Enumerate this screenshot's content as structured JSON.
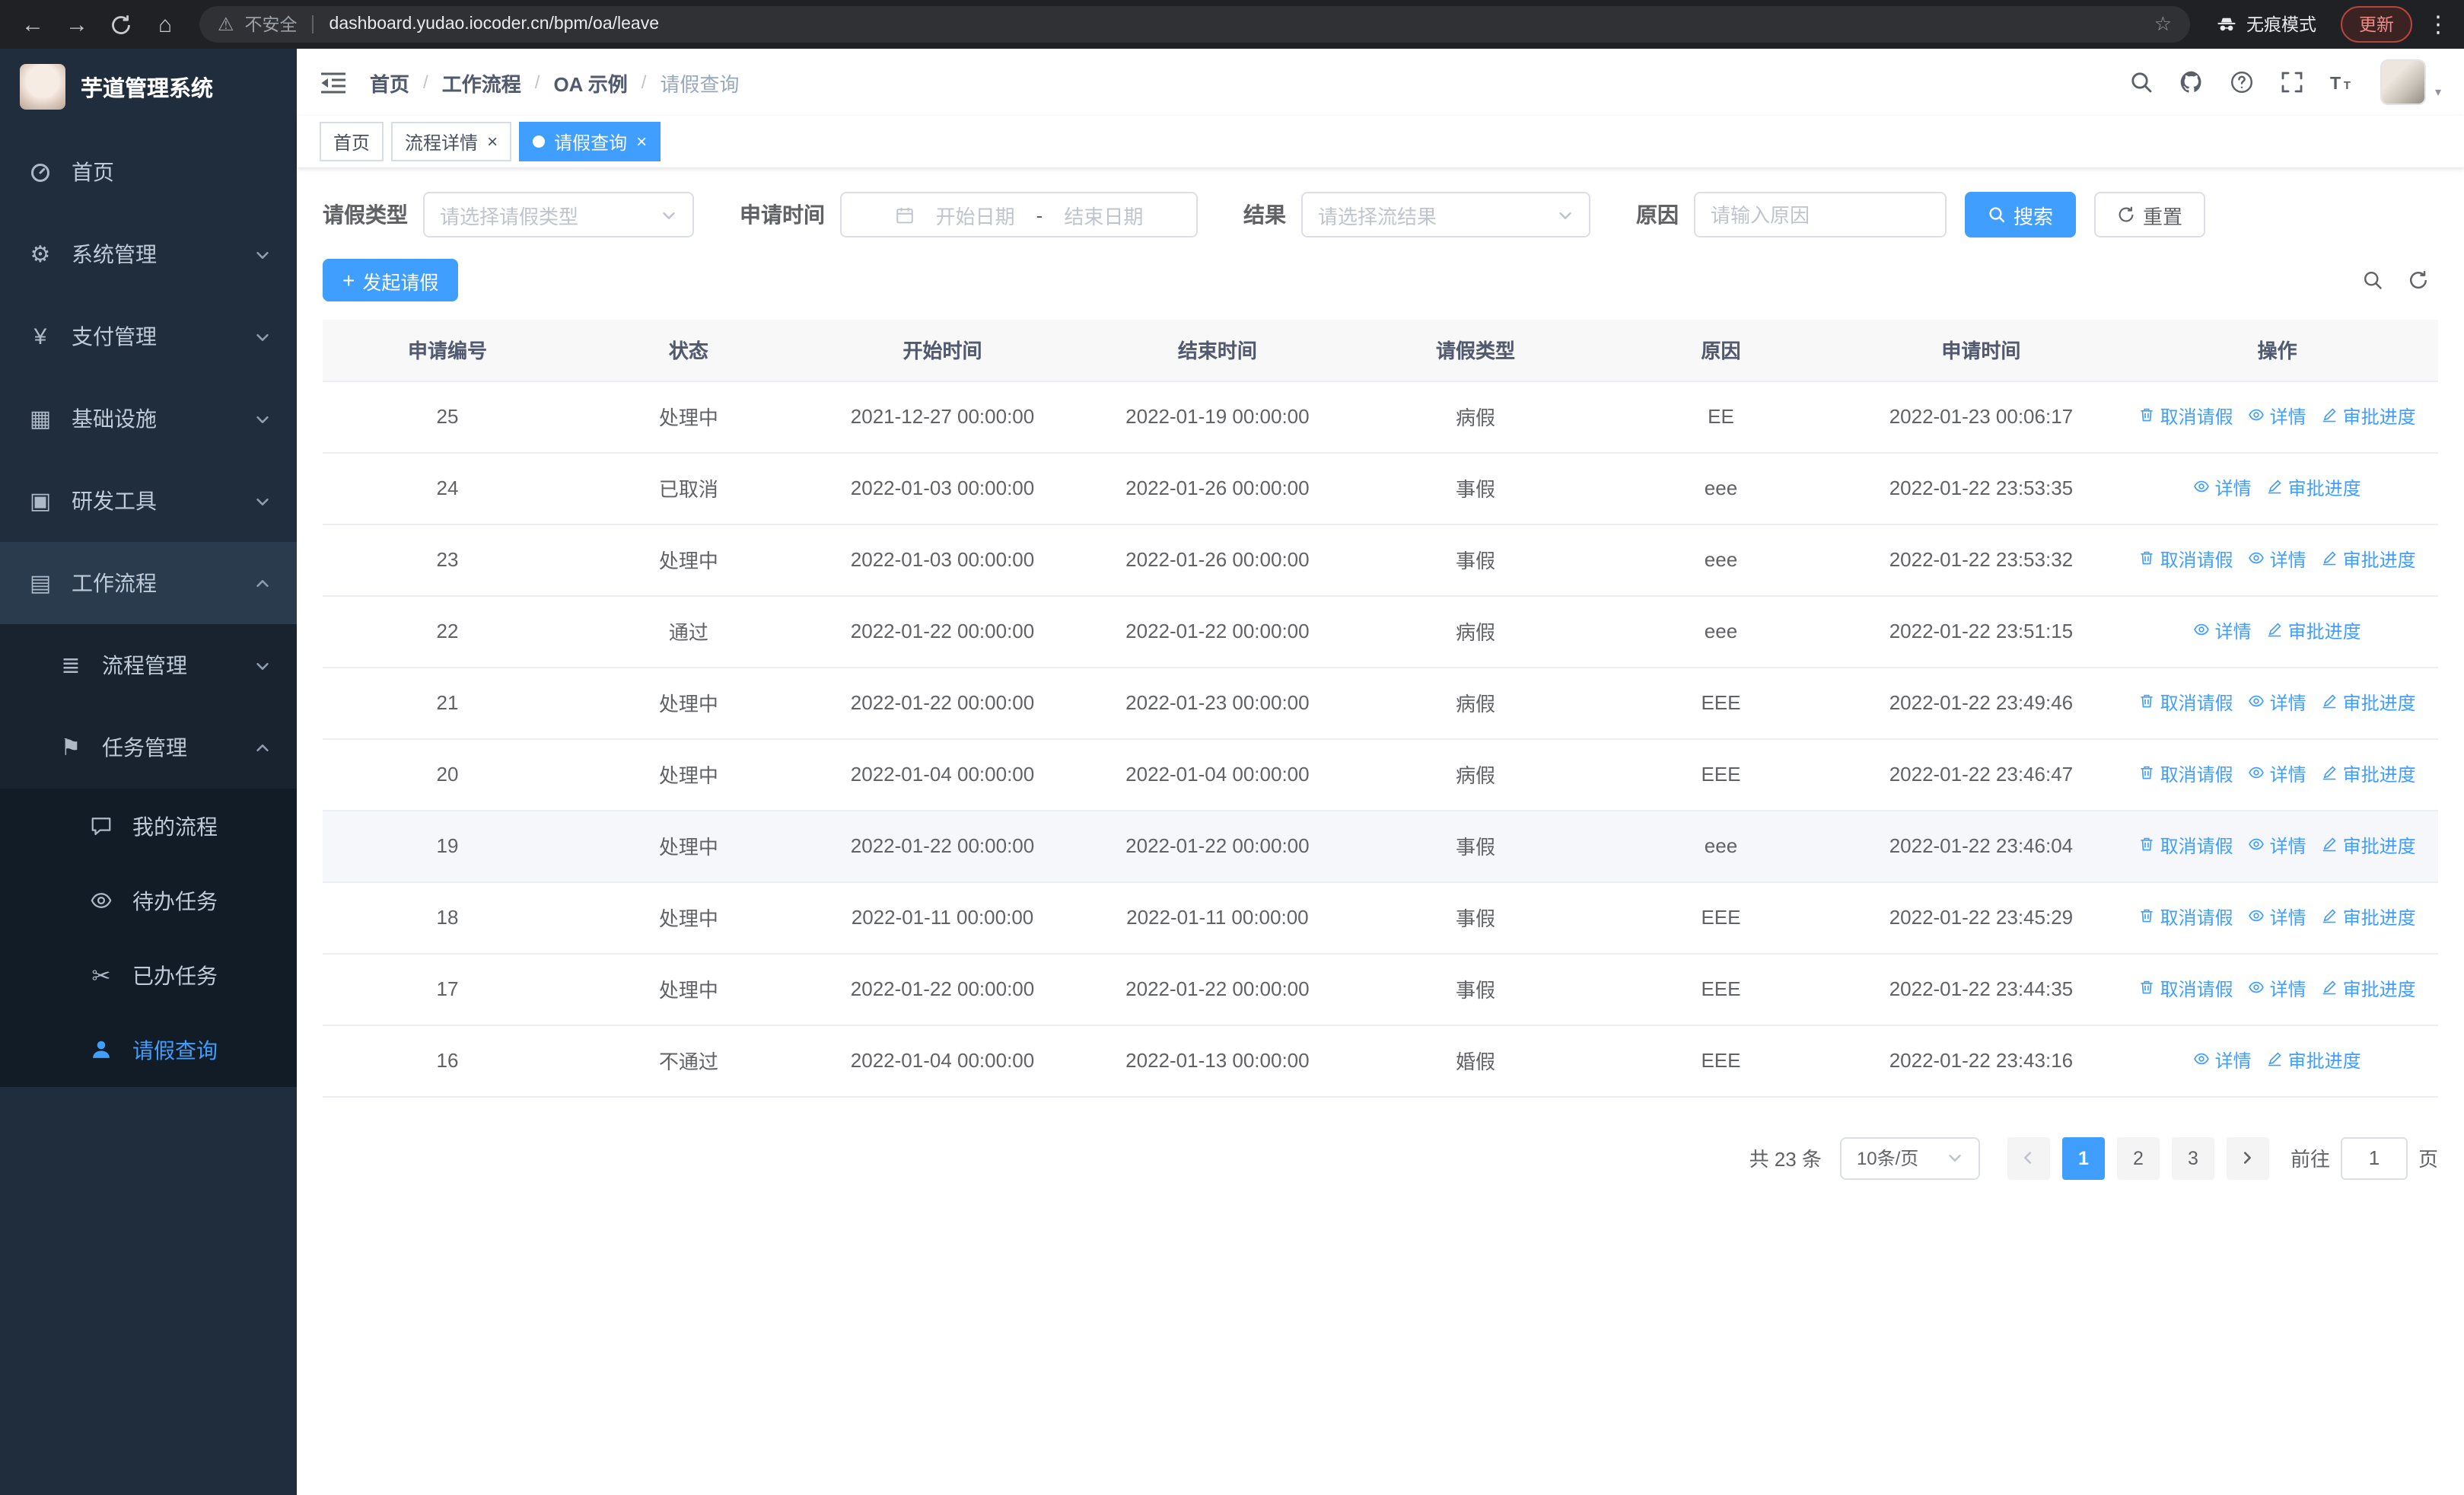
{
  "browser": {
    "security_text": "不安全",
    "url": "dashboard.yudao.iocoder.cn/bpm/oa/leave",
    "incognito_label": "无痕模式",
    "update_label": "更新"
  },
  "sidebar": {
    "logo_title": "芋道管理系统",
    "items": [
      {
        "key": "home",
        "label": "首页",
        "icon": "dashboard-icon",
        "level": 1
      },
      {
        "key": "system-management",
        "label": "系统管理",
        "icon": "gear-icon",
        "level": 1,
        "arrow": "down"
      },
      {
        "key": "payment-management",
        "label": "支付管理",
        "icon": "yen-icon",
        "level": 1,
        "arrow": "down"
      },
      {
        "key": "infrastructure",
        "label": "基础设施",
        "icon": "infra-icon",
        "level": 1,
        "arrow": "down"
      },
      {
        "key": "dev-tools",
        "label": "研发工具",
        "icon": "tools-icon",
        "level": 1,
        "arrow": "down"
      },
      {
        "key": "workflow",
        "label": "工作流程",
        "icon": "workflow-icon",
        "level": 1,
        "arrow": "up",
        "expanded": true
      },
      {
        "key": "process-management",
        "label": "流程管理",
        "icon": "process-icon",
        "level": 2,
        "arrow": "down"
      },
      {
        "key": "task-management",
        "label": "任务管理",
        "icon": "task-icon",
        "level": 2,
        "arrow": "up",
        "expanded": true
      },
      {
        "key": "my-process",
        "label": "我的流程",
        "icon": "chat-icon",
        "level": 3
      },
      {
        "key": "todo-tasks",
        "label": "待办任务",
        "icon": "eye-icon",
        "level": 3
      },
      {
        "key": "done-tasks",
        "label": "已办任务",
        "icon": "scissors-icon",
        "level": 3
      },
      {
        "key": "leave-query",
        "label": "请假查询",
        "icon": "user-icon",
        "level": 3,
        "active": true
      }
    ]
  },
  "header": {
    "breadcrumb": [
      "首页",
      "工作流程",
      "OA 示例",
      "请假查询"
    ]
  },
  "tabs": [
    {
      "label": "首页",
      "closable": false,
      "active": false
    },
    {
      "label": "流程详情",
      "closable": true,
      "active": false
    },
    {
      "label": "请假查询",
      "closable": true,
      "active": true
    }
  ],
  "filters": {
    "leave_type_label": "请假类型",
    "leave_type_placeholder": "请选择请假类型",
    "apply_time_label": "申请时间",
    "start_date_placeholder": "开始日期",
    "range_separator": "-",
    "end_date_placeholder": "结束日期",
    "result_label": "结果",
    "result_placeholder": "请选择流结果",
    "reason_label": "原因",
    "reason_placeholder": "请输入原因",
    "search_label": "搜索",
    "reset_label": "重置"
  },
  "toolbar": {
    "create_label": "发起请假"
  },
  "table": {
    "columns": [
      "申请编号",
      "状态",
      "开始时间",
      "结束时间",
      "请假类型",
      "原因",
      "申请时间",
      "操作"
    ],
    "action_types": {
      "cancel": {
        "label": "取消请假",
        "icon": "delete-icon"
      },
      "detail": {
        "label": "详情",
        "icon": "view-icon"
      },
      "progress": {
        "label": "审批进度",
        "icon": "edit-icon"
      }
    },
    "rows": [
      {
        "id": "25",
        "status": "处理中",
        "start": "2021-12-27 00:00:00",
        "end": "2022-01-19 00:00:00",
        "type": "病假",
        "reason": "EE",
        "apply_time": "2022-01-23 00:06:17",
        "actions": [
          "cancel",
          "detail",
          "progress"
        ]
      },
      {
        "id": "24",
        "status": "已取消",
        "start": "2022-01-03 00:00:00",
        "end": "2022-01-26 00:00:00",
        "type": "事假",
        "reason": "eee",
        "apply_time": "2022-01-22 23:53:35",
        "actions": [
          "detail",
          "progress"
        ]
      },
      {
        "id": "23",
        "status": "处理中",
        "start": "2022-01-03 00:00:00",
        "end": "2022-01-26 00:00:00",
        "type": "事假",
        "reason": "eee",
        "apply_time": "2022-01-22 23:53:32",
        "actions": [
          "cancel",
          "detail",
          "progress"
        ]
      },
      {
        "id": "22",
        "status": "通过",
        "start": "2022-01-22 00:00:00",
        "end": "2022-01-22 00:00:00",
        "type": "病假",
        "reason": "eee",
        "apply_time": "2022-01-22 23:51:15",
        "actions": [
          "detail",
          "progress"
        ]
      },
      {
        "id": "21",
        "status": "处理中",
        "start": "2022-01-22 00:00:00",
        "end": "2022-01-23 00:00:00",
        "type": "病假",
        "reason": "EEE",
        "apply_time": "2022-01-22 23:49:46",
        "actions": [
          "cancel",
          "detail",
          "progress"
        ]
      },
      {
        "id": "20",
        "status": "处理中",
        "start": "2022-01-04 00:00:00",
        "end": "2022-01-04 00:00:00",
        "type": "病假",
        "reason": "EEE",
        "apply_time": "2022-01-22 23:46:47",
        "actions": [
          "cancel",
          "detail",
          "progress"
        ]
      },
      {
        "id": "19",
        "status": "处理中",
        "start": "2022-01-22 00:00:00",
        "end": "2022-01-22 00:00:00",
        "type": "事假",
        "reason": "eee",
        "apply_time": "2022-01-22 23:46:04",
        "actions": [
          "cancel",
          "detail",
          "progress"
        ],
        "highlighted": true
      },
      {
        "id": "18",
        "status": "处理中",
        "start": "2022-01-11 00:00:00",
        "end": "2022-01-11 00:00:00",
        "type": "事假",
        "reason": "EEE",
        "apply_time": "2022-01-22 23:45:29",
        "actions": [
          "cancel",
          "detail",
          "progress"
        ]
      },
      {
        "id": "17",
        "status": "处理中",
        "start": "2022-01-22 00:00:00",
        "end": "2022-01-22 00:00:00",
        "type": "事假",
        "reason": "EEE",
        "apply_time": "2022-01-22 23:44:35",
        "actions": [
          "cancel",
          "detail",
          "progress"
        ]
      },
      {
        "id": "16",
        "status": "不通过",
        "start": "2022-01-04 00:00:00",
        "end": "2022-01-13 00:00:00",
        "type": "婚假",
        "reason": "EEE",
        "apply_time": "2022-01-22 23:43:16",
        "actions": [
          "detail",
          "progress"
        ]
      }
    ]
  },
  "pagination": {
    "total_text": "共 23 条",
    "page_size": "10条/页",
    "pages": [
      "1",
      "2",
      "3"
    ],
    "active_page": "1",
    "goto_label": "前往",
    "goto_value": "1",
    "unit_label": "页"
  }
}
